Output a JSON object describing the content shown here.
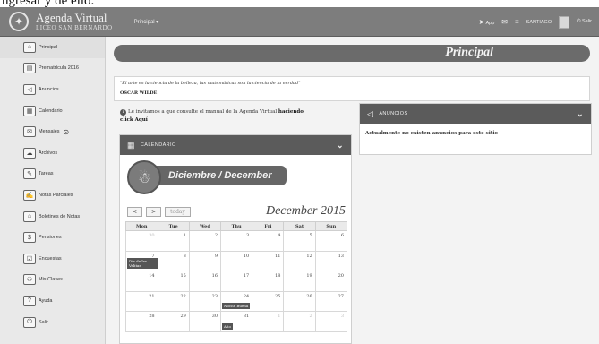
{
  "top_text": "ngresar y de ello.",
  "header": {
    "app_title": "Agenda Virtual",
    "app_subtitle": "LICEO SAN BERNARDO",
    "menu_label": "Principal ▾",
    "app_link": "App",
    "user_name": "SANTIAGO",
    "logout_label": "Salir"
  },
  "sidebar": {
    "items": [
      {
        "label": "Principal",
        "icon": "home-icon"
      },
      {
        "label": "Prematrícula 2016",
        "icon": "id-card-icon"
      },
      {
        "label": "Anuncios",
        "icon": "megaphone-icon"
      },
      {
        "label": "Calendario",
        "icon": "calendar-icon"
      },
      {
        "label": "Mensajes",
        "icon": "mail-icon"
      },
      {
        "label": "Archivos",
        "icon": "cloud-icon"
      },
      {
        "label": "Tareas",
        "icon": "task-icon"
      },
      {
        "label": "Notas Parciales",
        "icon": "notes-icon"
      },
      {
        "label": "Boletines de Notas",
        "icon": "bulletin-icon"
      },
      {
        "label": "Pensiones",
        "icon": "money-icon"
      },
      {
        "label": "Encuestas",
        "icon": "survey-icon"
      },
      {
        "label": "Mis Clases",
        "icon": "classes-icon"
      },
      {
        "label": "Ayuda",
        "icon": "help-icon"
      },
      {
        "label": "Salir",
        "icon": "exit-icon"
      }
    ]
  },
  "main": {
    "page_title": "Principal",
    "quote": "\"El arte es la ciencia de la belleza, las matemáticas son la ciencia de la verdad\"",
    "quote_author": "OSCAR WILDE",
    "manual_note_prefix": "Le invitamos a que consulte el manual de la Agenda Virtual",
    "manual_note_link": "haciendo click Aquí"
  },
  "calendar_panel": {
    "header_label": "CALENDARIO",
    "badge_label": "Diciembre / December",
    "prev_label": "<",
    "next_label": ">",
    "today_label": "today",
    "month_title": "December 2015",
    "weekdays": [
      "Mon",
      "Tue",
      "Wed",
      "Thu",
      "Fri",
      "Sat",
      "Sun"
    ]
  },
  "announcements_panel": {
    "header_label": "ANUNCIOS",
    "body_text": "Actualmente no existen anuncios para este sitio"
  },
  "events": {
    "e1": "Día de las Velitas",
    "e2": "Noche Buena",
    "e3": "Año"
  }
}
